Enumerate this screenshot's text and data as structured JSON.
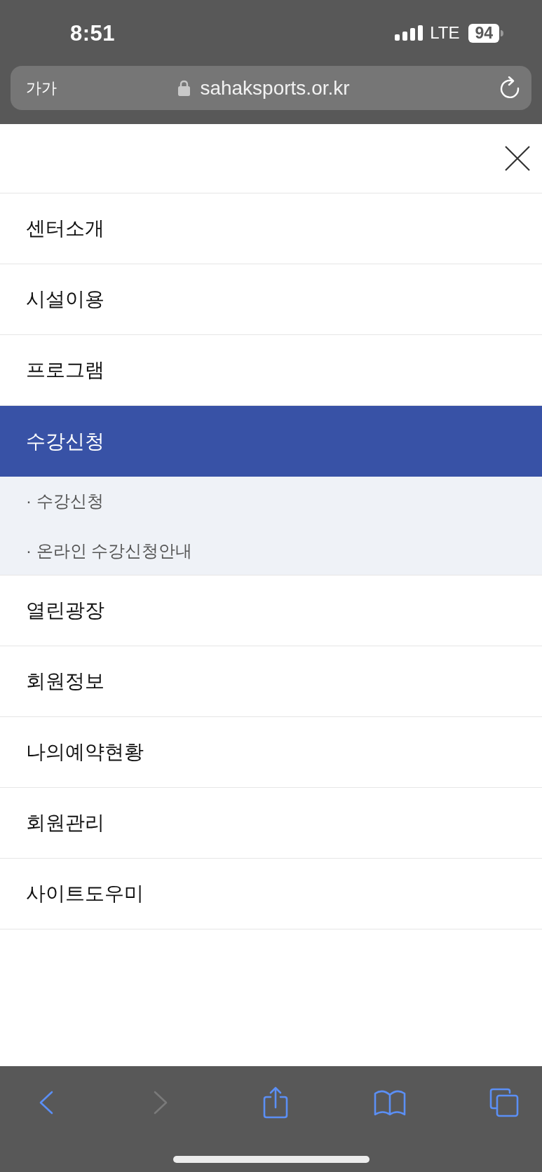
{
  "status_bar": {
    "time": "8:51",
    "network": "LTE",
    "battery": "94"
  },
  "address_bar": {
    "text_size_button": "가가",
    "url": "sahaksports.or.kr"
  },
  "menu": {
    "items": [
      {
        "label": "센터소개",
        "selected": false
      },
      {
        "label": "시설이용",
        "selected": false
      },
      {
        "label": "프로그램",
        "selected": false
      },
      {
        "label": "수강신청",
        "selected": true,
        "children": [
          {
            "label": "· 수강신청"
          },
          {
            "label": "· 온라인 수강신청안내"
          }
        ]
      },
      {
        "label": "열린광장",
        "selected": false
      },
      {
        "label": "회원정보",
        "selected": false
      },
      {
        "label": "나의예약현황",
        "selected": false
      },
      {
        "label": "회원관리",
        "selected": false
      },
      {
        "label": "사이트도우미",
        "selected": false
      }
    ]
  },
  "toolbar": {
    "buttons": [
      {
        "kind": "back",
        "disabled": false
      },
      {
        "kind": "forward",
        "disabled": true
      },
      {
        "kind": "share",
        "disabled": false
      },
      {
        "kind": "bookmarks",
        "disabled": false
      },
      {
        "kind": "tabs",
        "disabled": false
      }
    ]
  }
}
